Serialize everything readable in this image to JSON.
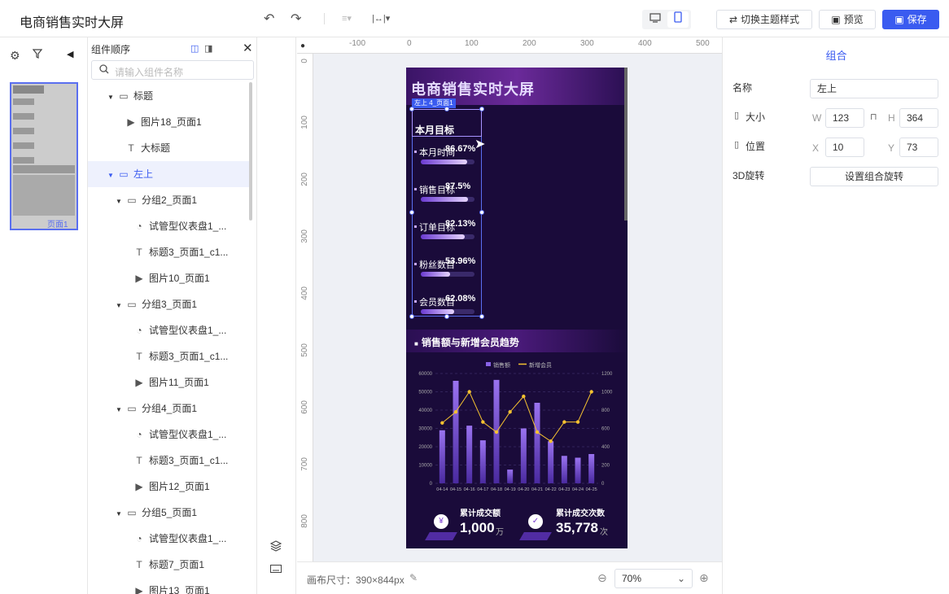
{
  "app": {
    "title": "电商销售实时大屏"
  },
  "toolbar": {
    "undo": "↶",
    "redo": "↷",
    "align_icon": "≡▾",
    "distribute_icon": "|↔|▾",
    "theme_label": "切换主题样式",
    "preview_label": "预览",
    "save_label": "保存",
    "desktop_icon": "desktop-icon",
    "mobile_icon": "mobile-icon"
  },
  "layers": {
    "header": "组件顺序",
    "search_placeholder": "请输入组件名称",
    "items": [
      {
        "label": "标题",
        "type": "group",
        "level": 0
      },
      {
        "label": "图片18_页面1",
        "type": "image",
        "level": 1
      },
      {
        "label": "大标题",
        "type": "text",
        "level": 1
      },
      {
        "label": "左上",
        "type": "group",
        "level": 0,
        "selected": true
      },
      {
        "label": "分组2_页面1",
        "type": "group",
        "level": 1
      },
      {
        "label": "试管型仪表盘1_...",
        "type": "gauge",
        "level": 2
      },
      {
        "label": "标题3_页面1_c1...",
        "type": "text",
        "level": 2
      },
      {
        "label": "图片10_页面1",
        "type": "image",
        "level": 2
      },
      {
        "label": "分组3_页面1",
        "type": "group",
        "level": 1
      },
      {
        "label": "试管型仪表盘1_...",
        "type": "gauge",
        "level": 2
      },
      {
        "label": "标题3_页面1_c1...",
        "type": "text",
        "level": 2
      },
      {
        "label": "图片11_页面1",
        "type": "image",
        "level": 2
      },
      {
        "label": "分组4_页面1",
        "type": "group",
        "level": 1
      },
      {
        "label": "试管型仪表盘1_...",
        "type": "gauge",
        "level": 2
      },
      {
        "label": "标题3_页面1_c1...",
        "type": "text",
        "level": 2
      },
      {
        "label": "图片12_页面1",
        "type": "image",
        "level": 2
      },
      {
        "label": "分组5_页面1",
        "type": "group",
        "level": 1
      },
      {
        "label": "试管型仪表盘1_...",
        "type": "gauge",
        "level": 2
      },
      {
        "label": "标题7_页面1",
        "type": "text",
        "level": 2
      },
      {
        "label": "图片13_页面1",
        "type": "image",
        "level": 2
      }
    ]
  },
  "thumb_label": "页面1",
  "ruler": {
    "h": [
      "-100",
      "0",
      "100",
      "200",
      "300",
      "400",
      "500"
    ],
    "v": [
      "0",
      "100",
      "200",
      "300",
      "400",
      "500",
      "600",
      "700",
      "800"
    ]
  },
  "canvas": {
    "title": "电商销售实时大屏",
    "selection_tag": "左上",
    "selection_tag2": "4_页面1",
    "kpi_title": "本月目标",
    "kpis": [
      {
        "label": "本月时间",
        "value": "86.67%",
        "pct": 0.87
      },
      {
        "label": "销售目标",
        "value": "87.5%",
        "pct": 0.88
      },
      {
        "label": "订单目标",
        "value": "82.13%",
        "pct": 0.82
      },
      {
        "label": "粉丝数目",
        "value": "53.96%",
        "pct": 0.54
      },
      {
        "label": "会员数目",
        "value": "62.08%",
        "pct": 0.62
      }
    ],
    "chart_title": "销售额与新增会员趋势",
    "stat1_label": "累计成交额",
    "stat1_value": "1,000",
    "stat1_unit": "万",
    "stat2_label": "累计成交次数",
    "stat2_value": "35,778",
    "stat2_unit": "次"
  },
  "chart_data": {
    "type": "bar",
    "categories": [
      "04-14",
      "04-15",
      "04-16",
      "04-17",
      "04-18",
      "04-19",
      "04-20",
      "04-21",
      "04-22",
      "04-23",
      "04-24",
      "04-25"
    ],
    "series": [
      {
        "name": "销售额",
        "type": "bar",
        "axis": "left",
        "values": [
          29000,
          56000,
          31500,
          23500,
          56500,
          7500,
          30000,
          44000,
          23000,
          15000,
          14000,
          16000
        ]
      },
      {
        "name": "新增会员",
        "type": "line",
        "axis": "right",
        "values": [
          660,
          780,
          1000,
          670,
          560,
          780,
          950,
          560,
          460,
          670,
          670,
          1000
        ]
      }
    ],
    "ylim_left": [
      0,
      60000
    ],
    "ylim_right": [
      0,
      1200
    ],
    "yticks_left": [
      "60000",
      "50000",
      "40000",
      "30000",
      "20000",
      "10000",
      "0"
    ],
    "yticks_right": [
      "1200",
      "1000",
      "800",
      "600",
      "400",
      "200",
      "0"
    ],
    "legend": "top-center",
    "colors": {
      "bar": "#8a63e8",
      "line": "#f5c230"
    }
  },
  "bottom": {
    "canvas_size_label": "画布尺寸：390×844px",
    "zoom": "70%"
  },
  "props": {
    "title": "组合",
    "name_label": "名称",
    "name_value": "左上",
    "size_label": "大小",
    "w_label": "W",
    "w_value": "123",
    "h_label": "H",
    "h_value": "364",
    "pos_label": "位置",
    "x_label": "X",
    "x_value": "10",
    "y_label": "Y",
    "y_value": "73",
    "rot_label": "3D旋转",
    "rot_button": "设置组合旋转"
  }
}
